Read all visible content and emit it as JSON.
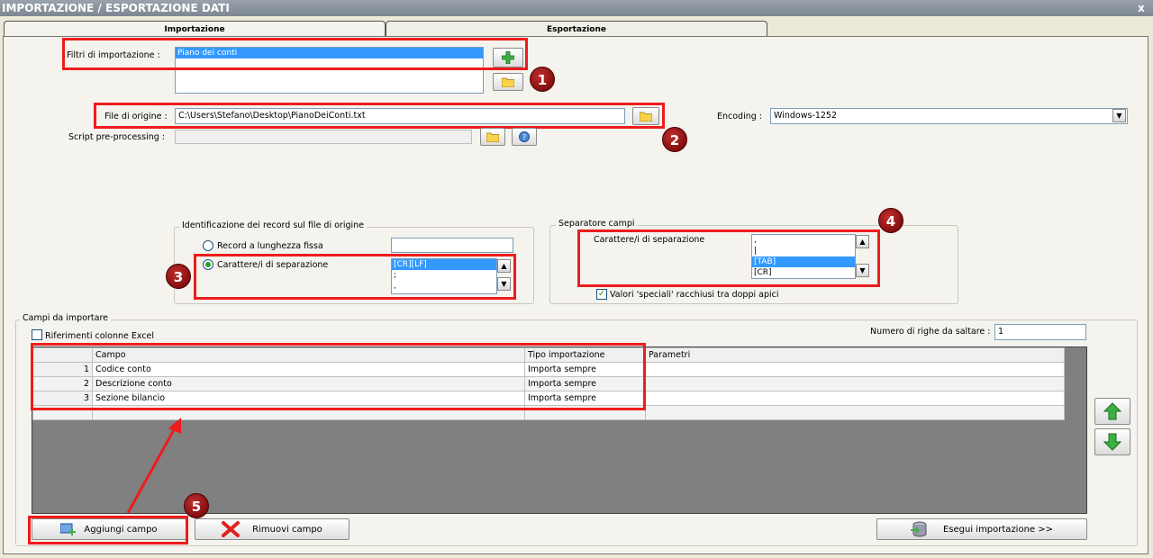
{
  "window": {
    "title": "IMPORTAZIONE / ESPORTAZIONE DATI",
    "close_glyph": "x"
  },
  "tabs": [
    {
      "label": "Importazione"
    },
    {
      "label": "Esportazione"
    }
  ],
  "filters": {
    "label": "Filtri di importazione :",
    "items": [
      "Piano dei conti"
    ]
  },
  "source": {
    "label": "File di origine :",
    "value": "C:\\Users\\Stefano\\Desktop\\PianoDeiConti.txt"
  },
  "preprocessing": {
    "label": "Script pre-processing :",
    "value": ""
  },
  "encoding": {
    "label": "Encoding :",
    "value": "Windows-1252"
  },
  "record_id": {
    "title": "Identificazione dei record sul file di origine",
    "fixed_label": "Record a lunghezza fissa",
    "sep_label": "Carattere/i di separazione",
    "sep_options": [
      "[CR][LF]",
      ";",
      ","
    ]
  },
  "field_sep": {
    "title": "Separatore campi",
    "label": "Carattere/i di separazione",
    "options": [
      ",",
      "|",
      "[TAB]",
      "[CR]"
    ],
    "quoted_label": "Valori 'speciali' racchiusi tra doppi apici"
  },
  "fields": {
    "title": "Campi da importare",
    "excel_ref_label": "Riferimenti colonne Excel",
    "skip_rows_label": "Numero di righe da saltare :",
    "skip_rows_value": "1",
    "columns": [
      "Campo",
      "Tipo importazione",
      "Parametri"
    ],
    "rows": [
      {
        "n": "1",
        "campo": "Codice conto",
        "tipo": "Importa sempre",
        "param": ""
      },
      {
        "n": "2",
        "campo": "Descrizione conto",
        "tipo": "Importa sempre",
        "param": ""
      },
      {
        "n": "3",
        "campo": "Sezione bilancio",
        "tipo": "Importa sempre",
        "param": ""
      }
    ]
  },
  "buttons": {
    "add": "Aggiungi campo",
    "remove": "Rimuovi campo",
    "run": "Esegui importazione >>"
  },
  "callouts": [
    "1",
    "2",
    "3",
    "4",
    "5"
  ],
  "colors": {
    "highlight": "#ee1c1c",
    "badge": "#8b0000",
    "selection": "#3399ff",
    "arrow_up": "#21a121"
  }
}
